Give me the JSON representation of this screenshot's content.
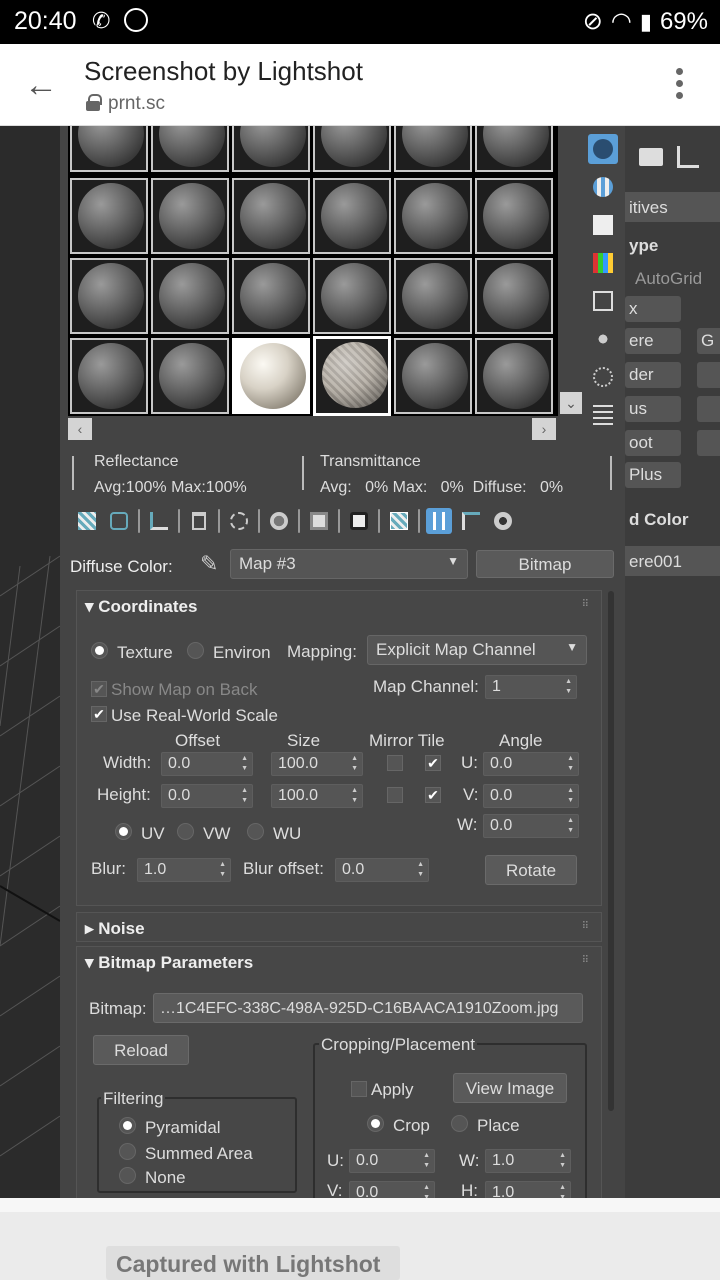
{
  "status": {
    "time": "20:40",
    "battery": "69%"
  },
  "browser": {
    "title": "Screenshot by Lightshot",
    "url": "prnt.sc"
  },
  "editor": {
    "reflectance_label": "Reflectance",
    "reflectance_value": "Avg:100% Max:100%",
    "transmittance_label": "Transmittance",
    "transmittance_value": "Avg:   0% Max:   0%  Diffuse:   0%",
    "diffuse_label": "Diffuse Color:",
    "map_select": "Map #3",
    "map_type_button": "Bitmap"
  },
  "coordinates": {
    "title": "Coordinates",
    "texture": "Texture",
    "environ": "Environ",
    "mapping_label": "Mapping:",
    "mapping_value": "Explicit Map Channel",
    "show_map_on_back": "Show Map on Back",
    "map_channel_label": "Map Channel:",
    "map_channel_value": "1",
    "use_real_world_scale": "Use Real-World Scale",
    "col_offset": "Offset",
    "col_size": "Size",
    "col_mirror_tile": "Mirror Tile",
    "col_angle": "Angle",
    "width_label": "Width:",
    "height_label": "Height:",
    "width_offset": "0.0",
    "height_offset": "0.0",
    "width_size": "100.0",
    "height_size": "100.0",
    "u_label": "U:",
    "v_label": "V:",
    "w_label": "W:",
    "u_angle": "0.0",
    "v_angle": "0.0",
    "w_angle": "0.0",
    "uv": "UV",
    "vw": "VW",
    "wu": "WU",
    "blur_label": "Blur:",
    "blur_value": "1.0",
    "blur_offset_label": "Blur offset:",
    "blur_offset_value": "0.0",
    "rotate": "Rotate"
  },
  "noise": {
    "title": "Noise"
  },
  "bitmap_params": {
    "title": "Bitmap Parameters",
    "bitmap_label": "Bitmap:",
    "bitmap_path": "…1C4EFC-338C-498A-925D-C16BAACA1910Zoom.jpg",
    "reload": "Reload",
    "filtering": "Filtering",
    "pyramidal": "Pyramidal",
    "summed_area": "Summed Area",
    "none": "None",
    "cropping": "Cropping/Placement",
    "apply": "Apply",
    "view_image": "View Image",
    "crop": "Crop",
    "place": "Place",
    "u_label": "U:",
    "v_label": "V:",
    "w_label": "W:",
    "h_label": "H:",
    "u_value": "0.0",
    "v_value": "0.0",
    "w_value": "1.0",
    "h_value": "1.0"
  },
  "side": {
    "primitives": "itives",
    "type": "ype",
    "autogrid": "AutoGrid",
    "b1": "x",
    "b2": "ere",
    "b2b": "G",
    "b3": "der",
    "b4": "us",
    "b5": "oot",
    "b6": "Plus",
    "color": "d Color",
    "name": "ere001"
  },
  "footer": {
    "caption": "Captured with Lightshot"
  }
}
